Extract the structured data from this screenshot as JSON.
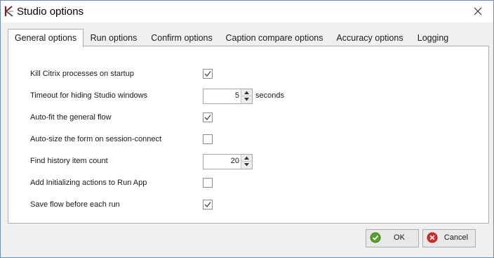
{
  "window": {
    "title": "Studio options",
    "app_icon": "app-logo-icon",
    "close_icon": "close-icon"
  },
  "tabs": [
    {
      "label": "General options",
      "active": true
    },
    {
      "label": "Run options",
      "active": false
    },
    {
      "label": "Confirm options",
      "active": false
    },
    {
      "label": "Caption compare options",
      "active": false
    },
    {
      "label": "Accuracy options",
      "active": false
    },
    {
      "label": "Logging",
      "active": false
    }
  ],
  "options": {
    "kill_citrix": {
      "label": "Kill Citrix processes on startup",
      "checked": true
    },
    "timeout": {
      "label": "Timeout for hiding Studio windows",
      "value": "5",
      "unit": "seconds"
    },
    "auto_fit": {
      "label": "Auto-fit the general flow",
      "checked": true
    },
    "auto_size": {
      "label": "Auto-size the form on session-connect",
      "checked": false
    },
    "history_count": {
      "label": "Find history item count",
      "value": "20"
    },
    "add_init": {
      "label": "Add Initializing actions to Run App",
      "checked": false
    },
    "save_flow": {
      "label": "Save flow before each run",
      "checked": true
    }
  },
  "buttons": {
    "ok": "OK",
    "cancel": "Cancel"
  },
  "colors": {
    "ok_green": "#5aa02c",
    "cancel_red": "#d93025",
    "border_blue": "#6e8fb5"
  }
}
